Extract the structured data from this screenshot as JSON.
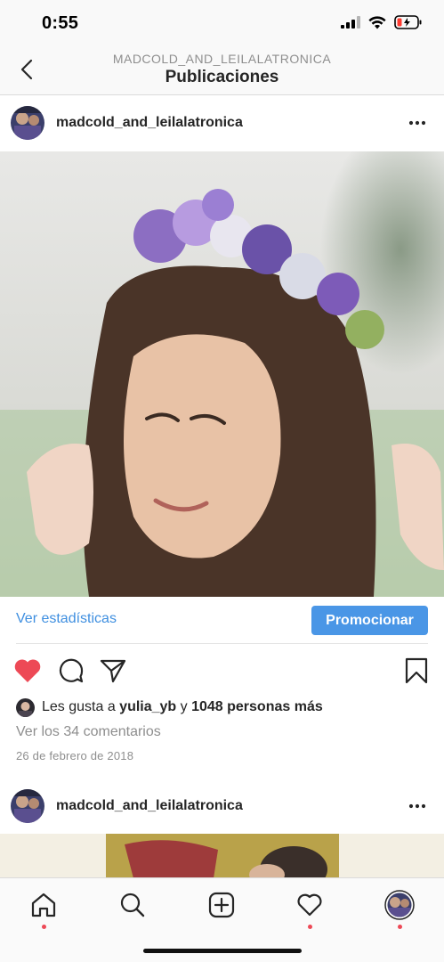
{
  "status_bar": {
    "time": "0:55"
  },
  "nav": {
    "subtitle": "MADCOLD_AND_LEILALATRONICA",
    "title": "Publicaciones"
  },
  "post": {
    "username": "madcold_and_leilalatronica",
    "insights_label": "Ver estadísticas",
    "promote_label": "Promocionar",
    "likes": {
      "prefix": "Les gusta a ",
      "first_user": "yulia_yb",
      "connector": " y ",
      "others": "1048 personas más"
    },
    "comments_label": "Ver los 34 comentarios",
    "date": "26 de febrero de 2018",
    "liked": true
  },
  "next_post": {
    "username": "madcold_and_leilalatronica"
  },
  "tab_bar": {
    "items": [
      "home-icon",
      "search-icon",
      "add-post-icon",
      "activity-heart-icon",
      "profile-avatar"
    ]
  },
  "colors": {
    "accent_blue": "#4a96e6",
    "link_blue": "#3f8fe0",
    "like_red": "#ed4956",
    "text": "#262626",
    "muted": "#8e8e8e"
  }
}
